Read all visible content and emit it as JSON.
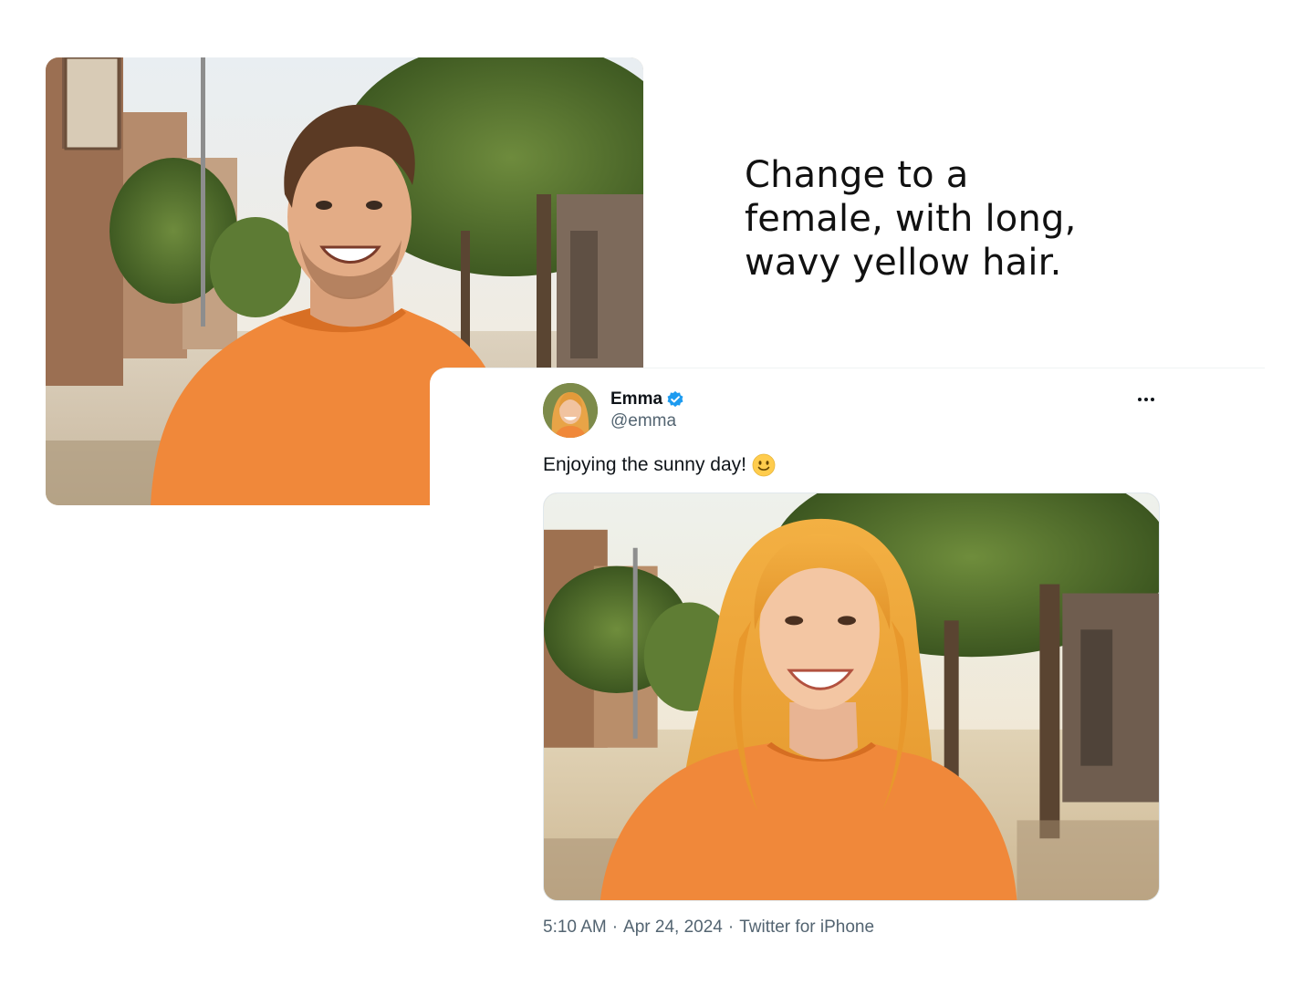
{
  "instruction": {
    "text": "Change to a\nfemale, with long,\nwavy yellow hair."
  },
  "tweet": {
    "display_name": "Emma",
    "handle": "@emma",
    "verified": true,
    "text": "Enjoying the sunny day!",
    "emoji_icon": "slightly-smiling-face-icon",
    "time": "5:10 AM",
    "date": "Apr 24, 2024",
    "source": "Twitter for iPhone",
    "separator": "·"
  },
  "colors": {
    "verified_blue": "#1d9bf0",
    "shirt_orange": "#f0883a",
    "secondary_text": "#536471"
  }
}
